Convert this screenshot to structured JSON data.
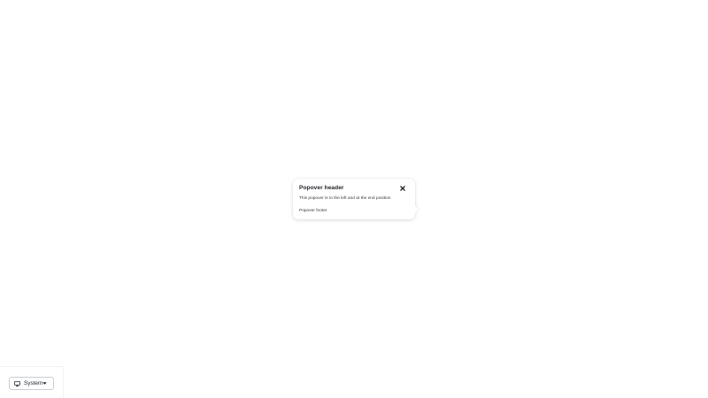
{
  "popover": {
    "title": "Popover header",
    "body": "This popover is to the left and at the end position",
    "footer": "Popover footer",
    "close_icon": "close-icon"
  },
  "theme_selector": {
    "selected": "System",
    "icon": "monitor-icon",
    "caret": "caret-down-icon"
  },
  "colors": {
    "background": "#ffffff",
    "text": "#1f2328",
    "border": "#c9ced4"
  }
}
